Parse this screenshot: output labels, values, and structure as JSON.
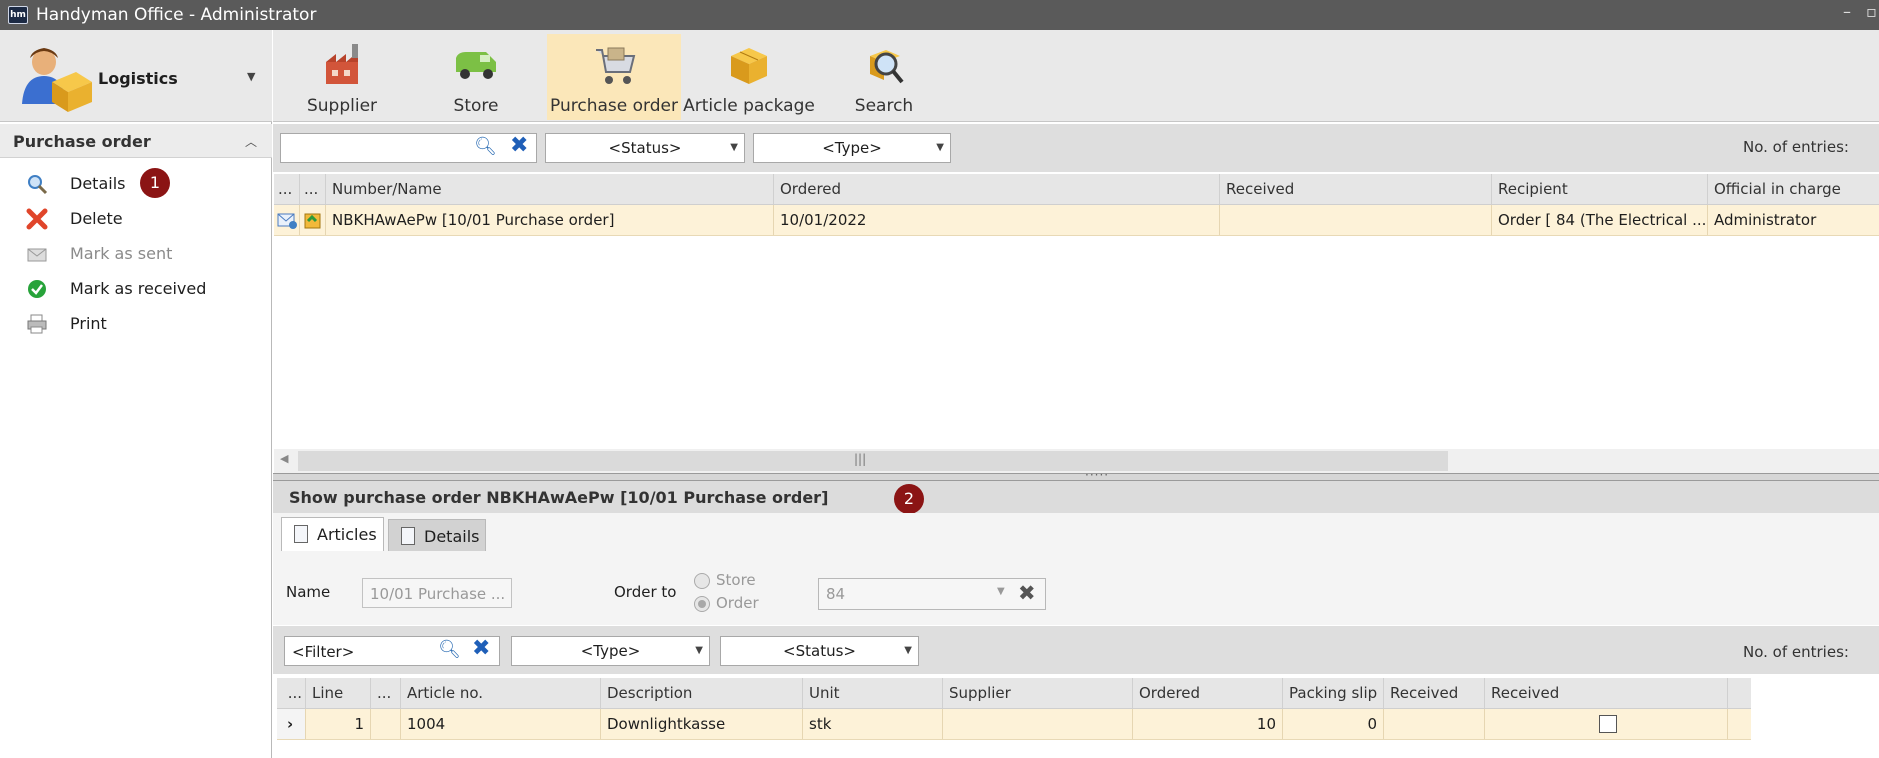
{
  "window": {
    "title": "Handyman Office - Administrator",
    "logo_text": "hm"
  },
  "module": {
    "label": "Logistics"
  },
  "section": {
    "title": "Purchase order"
  },
  "actions": [
    {
      "label": "Details",
      "icon": "magnifier-icon",
      "enabled": true
    },
    {
      "label": "Delete",
      "icon": "red-x-icon",
      "enabled": true
    },
    {
      "label": "Mark as sent",
      "icon": "envelope-icon",
      "enabled": false
    },
    {
      "label": "Mark as received",
      "icon": "green-check-icon",
      "enabled": true
    },
    {
      "label": "Print",
      "icon": "printer-icon",
      "enabled": true
    }
  ],
  "badges": [
    "1",
    "2"
  ],
  "ribbon": [
    {
      "label": "Supplier",
      "icon": "factory-icon",
      "active": false
    },
    {
      "label": "Store",
      "icon": "van-icon",
      "active": false
    },
    {
      "label": "Purchase order",
      "icon": "shopping-cart-icon",
      "active": true
    },
    {
      "label": "Article package",
      "icon": "boxes-icon",
      "active": false
    },
    {
      "label": "Search",
      "icon": "magnifier-box-icon",
      "active": false
    }
  ],
  "top_filter": {
    "search_value": "",
    "status": "<Status>",
    "type": "<Type>",
    "entries_label": "No. of entries:"
  },
  "orders_grid": {
    "headers": [
      "...",
      "...",
      "Number/Name",
      "Ordered",
      "Received",
      "Recipient",
      "Official in charge"
    ],
    "rows": [
      {
        "number_name": "NBKHAwAePw [10/01 Purchase order]",
        "ordered": "10/01/2022",
        "received": "",
        "recipient": "Order [ 84 (The Electrical ...",
        "official": "Administrator"
      }
    ]
  },
  "detail": {
    "title": "Show purchase order NBKHAwAePw [10/01 Purchase order]",
    "tabs": [
      "Articles",
      "Details"
    ],
    "name_label": "Name",
    "name_value": "10/01 Purchase ...",
    "order_to_label": "Order to",
    "radio_store": "Store",
    "radio_order": "Order",
    "order_to_value": "84"
  },
  "articles_filter": {
    "filter": "<Filter>",
    "type": "<Type>",
    "status": "<Status>",
    "entries_label": "No. of entries:"
  },
  "articles_grid": {
    "headers": [
      "...",
      "Line",
      "...",
      "Article no.",
      "Description",
      "Unit",
      "Supplier",
      "Ordered",
      "Packing slip",
      "Received",
      "Received"
    ],
    "rows": [
      {
        "line": "1",
        "article_no": "1004",
        "description": "Downlightkasse",
        "unit": "stk",
        "supplier": "",
        "ordered": "10",
        "packing_slip": "0",
        "received": ""
      }
    ]
  }
}
